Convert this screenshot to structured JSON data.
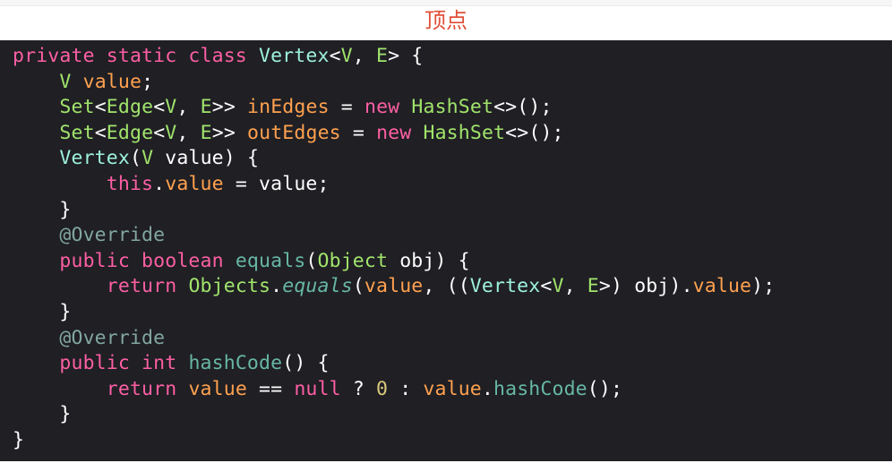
{
  "caption": "顶点",
  "code": {
    "language": "java",
    "lines": [
      {
        "tokens": [
          {
            "t": "private static class ",
            "c": "kw"
          },
          {
            "t": "Vertex",
            "c": "ty"
          },
          {
            "t": "<",
            "c": "pl"
          },
          {
            "t": "V",
            "c": "ty2"
          },
          {
            "t": ", ",
            "c": "pl"
          },
          {
            "t": "E",
            "c": "ty2"
          },
          {
            "t": "> {",
            "c": "pl"
          }
        ]
      },
      {
        "tokens": [
          {
            "t": "    ",
            "c": "pl"
          },
          {
            "t": "V",
            "c": "ty2"
          },
          {
            "t": " ",
            "c": "pl"
          },
          {
            "t": "value",
            "c": "pr"
          },
          {
            "t": ";",
            "c": "pl"
          }
        ]
      },
      {
        "tokens": [
          {
            "t": "    ",
            "c": "pl"
          },
          {
            "t": "Set",
            "c": "ty2"
          },
          {
            "t": "<",
            "c": "pl"
          },
          {
            "t": "Edge",
            "c": "ty2"
          },
          {
            "t": "<",
            "c": "pl"
          },
          {
            "t": "V",
            "c": "ty2"
          },
          {
            "t": ", ",
            "c": "pl"
          },
          {
            "t": "E",
            "c": "ty2"
          },
          {
            "t": ">> ",
            "c": "pl"
          },
          {
            "t": "inEdges",
            "c": "pr"
          },
          {
            "t": " = ",
            "c": "pl"
          },
          {
            "t": "new",
            "c": "kw"
          },
          {
            "t": " ",
            "c": "pl"
          },
          {
            "t": "HashSet",
            "c": "ty2"
          },
          {
            "t": "<>();",
            "c": "pl"
          }
        ]
      },
      {
        "tokens": [
          {
            "t": "    ",
            "c": "pl"
          },
          {
            "t": "Set",
            "c": "ty2"
          },
          {
            "t": "<",
            "c": "pl"
          },
          {
            "t": "Edge",
            "c": "ty2"
          },
          {
            "t": "<",
            "c": "pl"
          },
          {
            "t": "V",
            "c": "ty2"
          },
          {
            "t": ", ",
            "c": "pl"
          },
          {
            "t": "E",
            "c": "ty2"
          },
          {
            "t": ">> ",
            "c": "pl"
          },
          {
            "t": "outEdges",
            "c": "pr"
          },
          {
            "t": " = ",
            "c": "pl"
          },
          {
            "t": "new",
            "c": "kw"
          },
          {
            "t": " ",
            "c": "pl"
          },
          {
            "t": "HashSet",
            "c": "ty2"
          },
          {
            "t": "<>();",
            "c": "pl"
          }
        ]
      },
      {
        "tokens": [
          {
            "t": "    ",
            "c": "pl"
          },
          {
            "t": "Vertex",
            "c": "ty"
          },
          {
            "t": "(",
            "c": "pl"
          },
          {
            "t": "V",
            "c": "ty2"
          },
          {
            "t": " value) {",
            "c": "pl"
          }
        ]
      },
      {
        "tokens": [
          {
            "t": "        ",
            "c": "pl"
          },
          {
            "t": "this",
            "c": "kw"
          },
          {
            "t": ".",
            "c": "pl"
          },
          {
            "t": "value",
            "c": "pr"
          },
          {
            "t": " = value;",
            "c": "pl"
          }
        ]
      },
      {
        "tokens": [
          {
            "t": "    }",
            "c": "pl"
          }
        ]
      },
      {
        "tokens": [
          {
            "t": "    ",
            "c": "pl"
          },
          {
            "t": "@Override",
            "c": "an"
          }
        ]
      },
      {
        "tokens": [
          {
            "t": "    ",
            "c": "pl"
          },
          {
            "t": "public boolean",
            "c": "kw"
          },
          {
            "t": " ",
            "c": "pl"
          },
          {
            "t": "equals",
            "c": "fn"
          },
          {
            "t": "(",
            "c": "pl"
          },
          {
            "t": "Object",
            "c": "ty2"
          },
          {
            "t": " obj) {",
            "c": "pl"
          }
        ]
      },
      {
        "tokens": [
          {
            "t": "        ",
            "c": "pl"
          },
          {
            "t": "return",
            "c": "kw"
          },
          {
            "t": " ",
            "c": "pl"
          },
          {
            "t": "Objects",
            "c": "ty2"
          },
          {
            "t": ".",
            "c": "pl"
          },
          {
            "t": "equals",
            "c": "fn",
            "i": true
          },
          {
            "t": "(",
            "c": "pl"
          },
          {
            "t": "value",
            "c": "pr"
          },
          {
            "t": ", ((",
            "c": "pl"
          },
          {
            "t": "Vertex",
            "c": "ty"
          },
          {
            "t": "<",
            "c": "pl"
          },
          {
            "t": "V",
            "c": "ty2"
          },
          {
            "t": ", ",
            "c": "pl"
          },
          {
            "t": "E",
            "c": "ty2"
          },
          {
            "t": ">) obj).",
            "c": "pl"
          },
          {
            "t": "value",
            "c": "pr"
          },
          {
            "t": ");",
            "c": "pl"
          }
        ]
      },
      {
        "tokens": [
          {
            "t": "    }",
            "c": "pl"
          }
        ]
      },
      {
        "tokens": [
          {
            "t": "    ",
            "c": "pl"
          },
          {
            "t": "@Override",
            "c": "an"
          }
        ]
      },
      {
        "tokens": [
          {
            "t": "    ",
            "c": "pl"
          },
          {
            "t": "public int",
            "c": "kw"
          },
          {
            "t": " ",
            "c": "pl"
          },
          {
            "t": "hashCode",
            "c": "fn"
          },
          {
            "t": "() {",
            "c": "pl"
          }
        ]
      },
      {
        "tokens": [
          {
            "t": "        ",
            "c": "pl"
          },
          {
            "t": "return",
            "c": "kw"
          },
          {
            "t": " ",
            "c": "pl"
          },
          {
            "t": "value",
            "c": "pr"
          },
          {
            "t": " == ",
            "c": "pl"
          },
          {
            "t": "null",
            "c": "kw"
          },
          {
            "t": " ? ",
            "c": "pl"
          },
          {
            "t": "0",
            "c": "num"
          },
          {
            "t": " : ",
            "c": "pl"
          },
          {
            "t": "value",
            "c": "pr"
          },
          {
            "t": ".",
            "c": "pl"
          },
          {
            "t": "hashCode",
            "c": "fn"
          },
          {
            "t": "();",
            "c": "pl"
          }
        ]
      },
      {
        "tokens": [
          {
            "t": "    }",
            "c": "pl"
          }
        ]
      },
      {
        "tokens": [
          {
            "t": "}",
            "c": "pl"
          }
        ]
      }
    ]
  },
  "colors": {
    "caption": "#e04e39",
    "code_background": "#1f1f24",
    "keyword": "#fc5fa3",
    "type": "#a1e46b",
    "class_name": "#9ef1dd",
    "property": "#ffa14f",
    "method": "#67b7a4",
    "annotation": "#82a6a0",
    "number": "#d9c97c",
    "plain": "#ffffff"
  }
}
